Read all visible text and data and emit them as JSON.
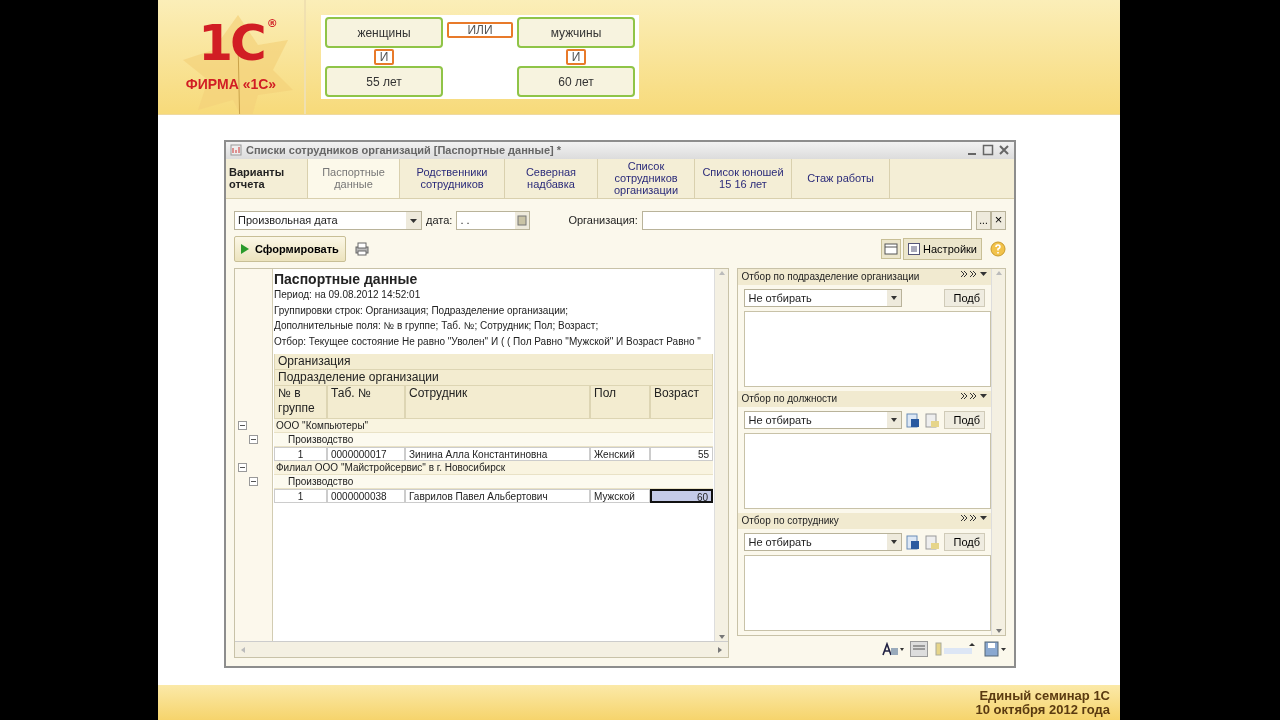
{
  "slide": {
    "logo": {
      "mark": "1С",
      "registered": "®",
      "caption": "ФИРМА «1С»"
    },
    "diagram": {
      "columns": [
        {
          "items": [
            {
              "kind": "condition",
              "text": "женщины"
            },
            {
              "kind": "operator",
              "text": "И"
            },
            {
              "kind": "condition",
              "text": "55 лет"
            }
          ]
        },
        {
          "items": [
            {
              "kind": "operator",
              "text": "ИЛИ"
            }
          ]
        },
        {
          "items": [
            {
              "kind": "condition",
              "text": "мужчины"
            },
            {
              "kind": "operator",
              "text": "И"
            },
            {
              "kind": "condition",
              "text": "60 лет"
            }
          ]
        }
      ]
    },
    "footer": [
      "Единый семинар 1С",
      "10 октября 2012 года"
    ]
  },
  "window": {
    "title": "Списки сотрудников организаций [Паспортные данные] *",
    "variants_button": "Варианты отчета",
    "tabs": [
      {
        "label": "Паспортные данные",
        "selected": true
      },
      {
        "label": "Родственники сотрудников",
        "selected": false
      },
      {
        "label": "Северная надбавка",
        "selected": false
      },
      {
        "label": "Список сотрудников организации",
        "selected": false
      },
      {
        "label": "Список юношей 15 16 лет",
        "selected": false
      },
      {
        "label": "Стаж работы",
        "selected": false
      }
    ],
    "filters": {
      "period": "Произвольная дата",
      "date_label": "дата:",
      "date_value": ". .",
      "org_label": "Организация:",
      "org_clear": "×",
      "org_choose": "..."
    },
    "generate_button": "Сформировать",
    "settings_button": "Настройки",
    "report": {
      "title": "Паспортные данные",
      "header_lines": [
        "Период: на 09.08.2012 14:52:01",
        "Группировки строк: Организация; Подразделение организации;",
        "Дополнительные поля: № в группе; Таб. №; Сотрудник; Пол; Возраст;",
        "Отбор: Текущее состояние Не равно \"Уволен\" И ( ( Пол Равно \"Мужской\" И Возраст Равно \""
      ],
      "grouping_headers": [
        "Организация",
        "Подразделение организации"
      ],
      "columns": [
        "№ в группе",
        "Таб. №",
        "Сотрудник",
        "Пол",
        "Возраст"
      ],
      "groups": [
        {
          "label": "ООО \"Компьютеры\"",
          "expanded": true,
          "children": [
            {
              "label": "Производство",
              "expanded": true,
              "rows": [
                {
                  "cells": [
                    "1",
                    "0000000017",
                    "Зинина Алла Константиновна",
                    "Женский",
                    "55"
                  ],
                  "selected": false
                }
              ]
            }
          ]
        },
        {
          "label": "Филиал ООО \"Майстройсервис\" в г. Новосибирск",
          "expanded": true,
          "children": [
            {
              "label": "Производство",
              "expanded": true,
              "rows": [
                {
                  "cells": [
                    "1",
                    "0000000038",
                    "Гаврилов Павел Альбертович",
                    "Мужской",
                    "60"
                  ],
                  "selected": true
                }
              ]
            }
          ]
        }
      ]
    },
    "filter_panels": [
      {
        "title": "Отбор по подразделение организации",
        "value": "Не отбирать",
        "button": "Подб",
        "kind": "plain"
      },
      {
        "title": "Отбор по должности",
        "value": "Не отбирать",
        "button": "Подб",
        "kind": "with-icons"
      },
      {
        "title": "Отбор по сотруднику",
        "value": "Не отбирать",
        "button": "Подб",
        "kind": "with-icons"
      }
    ]
  }
}
